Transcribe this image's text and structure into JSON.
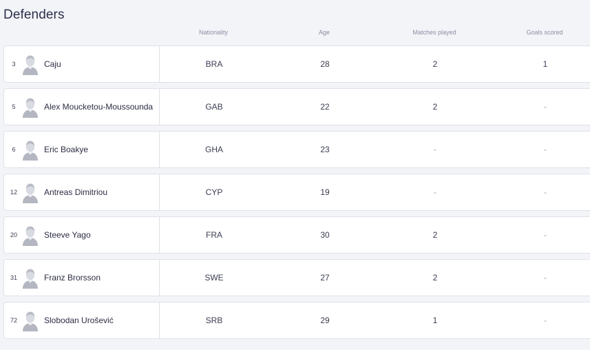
{
  "section": {
    "title": "Defenders"
  },
  "columns": {
    "nationality": "Nationality",
    "age": "Age",
    "matches_played": "Matches played",
    "goals_scored": "Goals scored"
  },
  "icons": {
    "avatar": "player-avatar-icon"
  },
  "colors": {
    "background": "#f3f4f8",
    "row_background": "#ffffff",
    "border": "#dfe1e9",
    "text": "#2b2d42",
    "muted": "#8a8fa3"
  },
  "players": [
    {
      "number": "3",
      "name": "Caju",
      "nationality": "BRA",
      "age": "28",
      "matches_played": "2",
      "goals_scored": "1"
    },
    {
      "number": "5",
      "name": "Alex Moucketou-Moussounda",
      "nationality": "GAB",
      "age": "22",
      "matches_played": "2",
      "goals_scored": "-"
    },
    {
      "number": "6",
      "name": "Eric Boakye",
      "nationality": "GHA",
      "age": "23",
      "matches_played": "-",
      "goals_scored": "-"
    },
    {
      "number": "12",
      "name": "Antreas Dimitriou",
      "nationality": "CYP",
      "age": "19",
      "matches_played": "-",
      "goals_scored": "-"
    },
    {
      "number": "20",
      "name": "Steeve Yago",
      "nationality": "FRA",
      "age": "30",
      "matches_played": "2",
      "goals_scored": "-"
    },
    {
      "number": "31",
      "name": "Franz Brorsson",
      "nationality": "SWE",
      "age": "27",
      "matches_played": "2",
      "goals_scored": "-"
    },
    {
      "number": "72",
      "name": "Slobodan Urošević",
      "nationality": "SRB",
      "age": "29",
      "matches_played": "1",
      "goals_scored": "-"
    }
  ]
}
